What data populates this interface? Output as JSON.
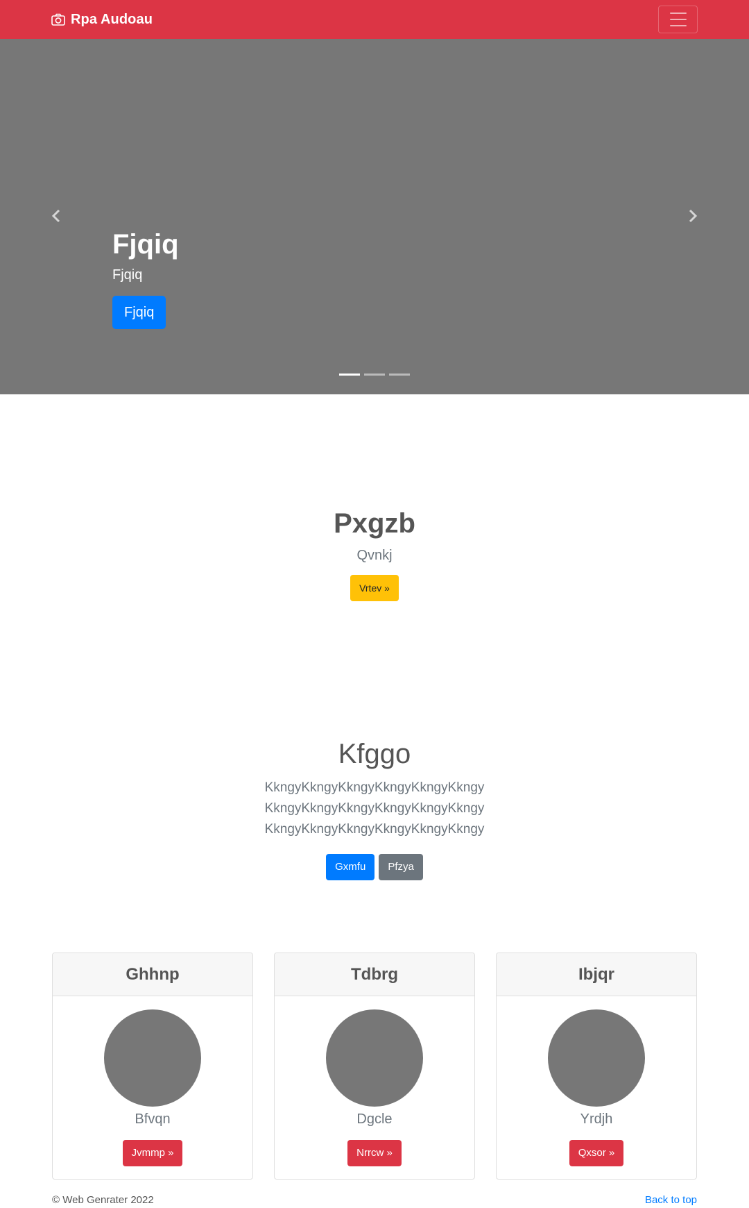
{
  "navbar": {
    "brand": "Rpa Audoau",
    "brand_icon": "camera-icon",
    "toggler_icon": "hamburger-icon",
    "bg_color": "#dc3545"
  },
  "carousel": {
    "title": "Fjqiq",
    "subtitle": "Fjqiq",
    "button_label": "Fjqiq",
    "bg_color": "#777777",
    "slide_count": 3,
    "active_slide": 1
  },
  "section1": {
    "title": "Pxgzb",
    "subtitle": "Qvnkj",
    "button_label": "Vrtev »"
  },
  "section2": {
    "title": "Kfggo",
    "lead": "KkngyKkngyKkngyKkngyKkngyKkngyKkngyKkngyKkngyKkngyKkngyKkngyKkngyKkngyKkngyKkngyKkngyKkngy",
    "primary_button": "Gxmfu",
    "secondary_button": "Pfzya"
  },
  "cards": [
    {
      "header": "Ghhnp",
      "name": "Bfvqn",
      "button_label": "Jvmmp »"
    },
    {
      "header": "Tdbrg",
      "name": "Dgcle",
      "button_label": "Nrrcw »"
    },
    {
      "header": "Ibjqr",
      "name": "Yrdjh",
      "button_label": "Qxsor »"
    }
  ],
  "footer": {
    "copyright": "© Web Genrater 2022",
    "back_to_top": "Back to top"
  }
}
